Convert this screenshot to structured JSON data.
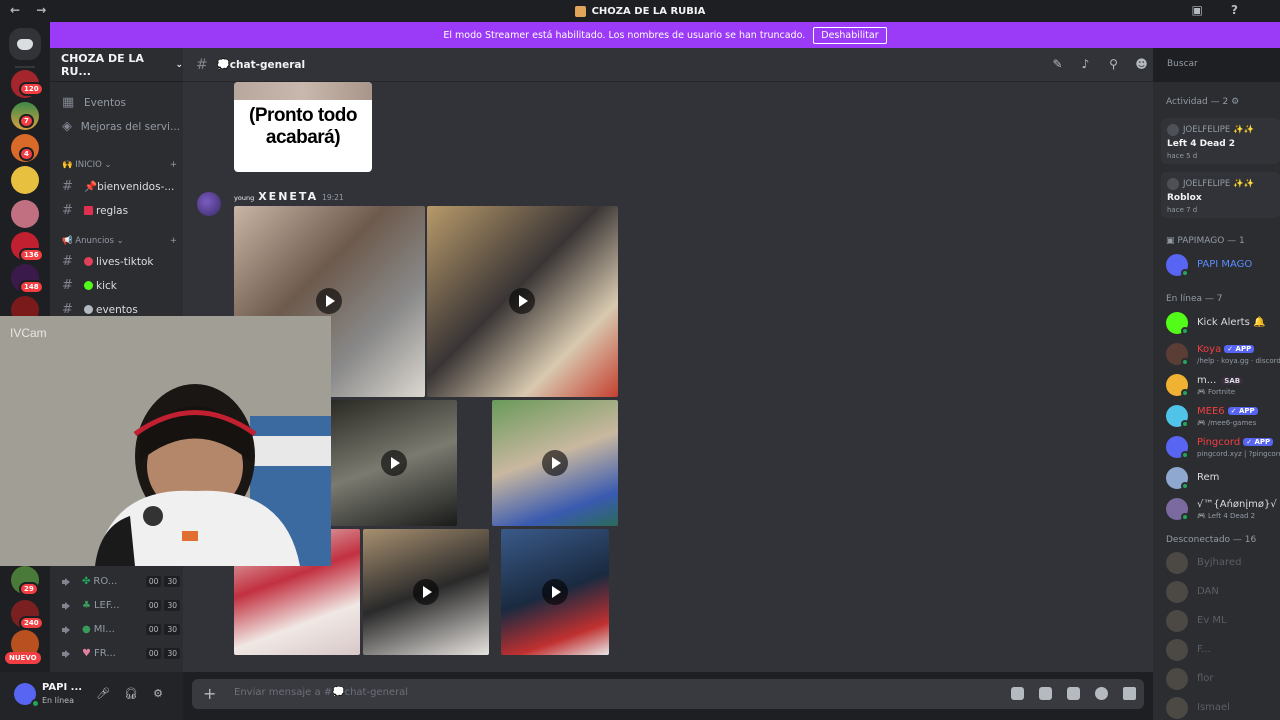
{
  "window": {
    "title": "CHOZA DE LA RUBIA",
    "nav": "← →"
  },
  "banner": {
    "text": "El modo Streamer está habilitado. Los nombres de usuario se han truncado.",
    "button": "Deshabilitar"
  },
  "guilds": {
    "badges": [
      "120",
      "7",
      "4",
      "136",
      "148",
      "29",
      "240"
    ],
    "nuevo": "NUEVO"
  },
  "server": {
    "name": "CHOZA DE LA RU...",
    "chevron": "⌄"
  },
  "channels": {
    "top": [
      {
        "label": "Eventos"
      },
      {
        "label": "Mejoras del servi..."
      }
    ],
    "inicio": {
      "label": "INICIO",
      "emoji": "🙌"
    },
    "inicio_items": [
      {
        "label": "bienvenidos-..."
      },
      {
        "label": "reglas"
      }
    ],
    "anuncios": {
      "label": "Anuncios",
      "emoji": "📢"
    },
    "anuncios_items": [
      {
        "label": "lives-tiktok"
      },
      {
        "label": "kick"
      },
      {
        "label": "eventos"
      }
    ],
    "voice": [
      {
        "label": "RO...",
        "a": "00",
        "b": "30"
      },
      {
        "label": "LEF...",
        "a": "00",
        "b": "30"
      },
      {
        "label": "MI...",
        "a": "00",
        "b": "30"
      },
      {
        "label": "FR...",
        "a": "00",
        "b": "30"
      }
    ]
  },
  "user": {
    "name": "PAPI ...",
    "status": "En línea"
  },
  "chat": {
    "channel": "💭chat-general",
    "sticker_text": "(Pronto todo acabará)",
    "message": {
      "prefix": "young",
      "author": "XENETA",
      "time": "19:21"
    },
    "placeholder": "Enviar mensaje a #💭chat-general"
  },
  "search": {
    "placeholder": "Buscar"
  },
  "members": {
    "activity_header": "Actividad — 2",
    "activities": [
      {
        "name": "JOELFELIPE ✨✨",
        "game": "Left 4 Dead 2",
        "time": "hace 5 d"
      },
      {
        "name": "JOELFELIPE ✨✨",
        "game": "Roblox",
        "time": "hace 7 d"
      }
    ],
    "role_header": "PAPIMAGO — 1",
    "role_member": {
      "name": "PAPI MAGO"
    },
    "online_header": "En línea — 7",
    "online": [
      {
        "name": "Kick Alerts 🔔",
        "sub": "",
        "color": "#dbdee1",
        "avatar": "#53fc18",
        "app": ""
      },
      {
        "name": "Koya",
        "sub": "/help · koya.gg · discord",
        "color": "#f23f43",
        "avatar": "#5a3e36",
        "app": "✓ APP"
      },
      {
        "name": "m...",
        "sub": "🎮 Fortnite",
        "color": "#dbdee1",
        "avatar": "#f0b232",
        "app": "",
        "tag": "SAB"
      },
      {
        "name": "MEE6",
        "sub": "🎮 /mee6-games",
        "color": "#f23f43",
        "avatar": "#4fc3e8",
        "app": "✓ APP"
      },
      {
        "name": "Pingcord",
        "sub": "pingcord.xyz | ?pingcord",
        "color": "#f23f43",
        "avatar": "#5865f2",
        "app": "✓ APP"
      },
      {
        "name": "Rem",
        "sub": "",
        "color": "#dbdee1",
        "avatar": "#8fa8d0",
        "app": ""
      },
      {
        "name": "√™{Ańønįmø}√",
        "sub": "🎮 Left 4 Dead 2",
        "color": "#dbdee1",
        "avatar": "#7a6aa0",
        "app": ""
      }
    ],
    "offline_header": "Desconectado — 16",
    "offline": [
      {
        "name": "Byjhared"
      },
      {
        "name": "DAN"
      },
      {
        "name": "Ev ML"
      },
      {
        "name": "F..."
      },
      {
        "name": "flor"
      },
      {
        "name": "Ismael"
      }
    ]
  },
  "cam": {
    "label": "IVCam"
  },
  "icons": [
    "discord-icon",
    "hash-icon",
    "speaker-icon",
    "mic-icon",
    "headphones-icon",
    "settings-icon",
    "threads-icon",
    "bell-icon",
    "pin-icon",
    "members-icon",
    "play-icon",
    "gift-icon",
    "gif-icon",
    "sticker-icon",
    "emoji-icon",
    "apps-icon"
  ],
  "colors": {
    "brand": "#5865f2",
    "banner": "#9b3bf7",
    "online": "#23a55a",
    "badge": "#f23f43"
  }
}
